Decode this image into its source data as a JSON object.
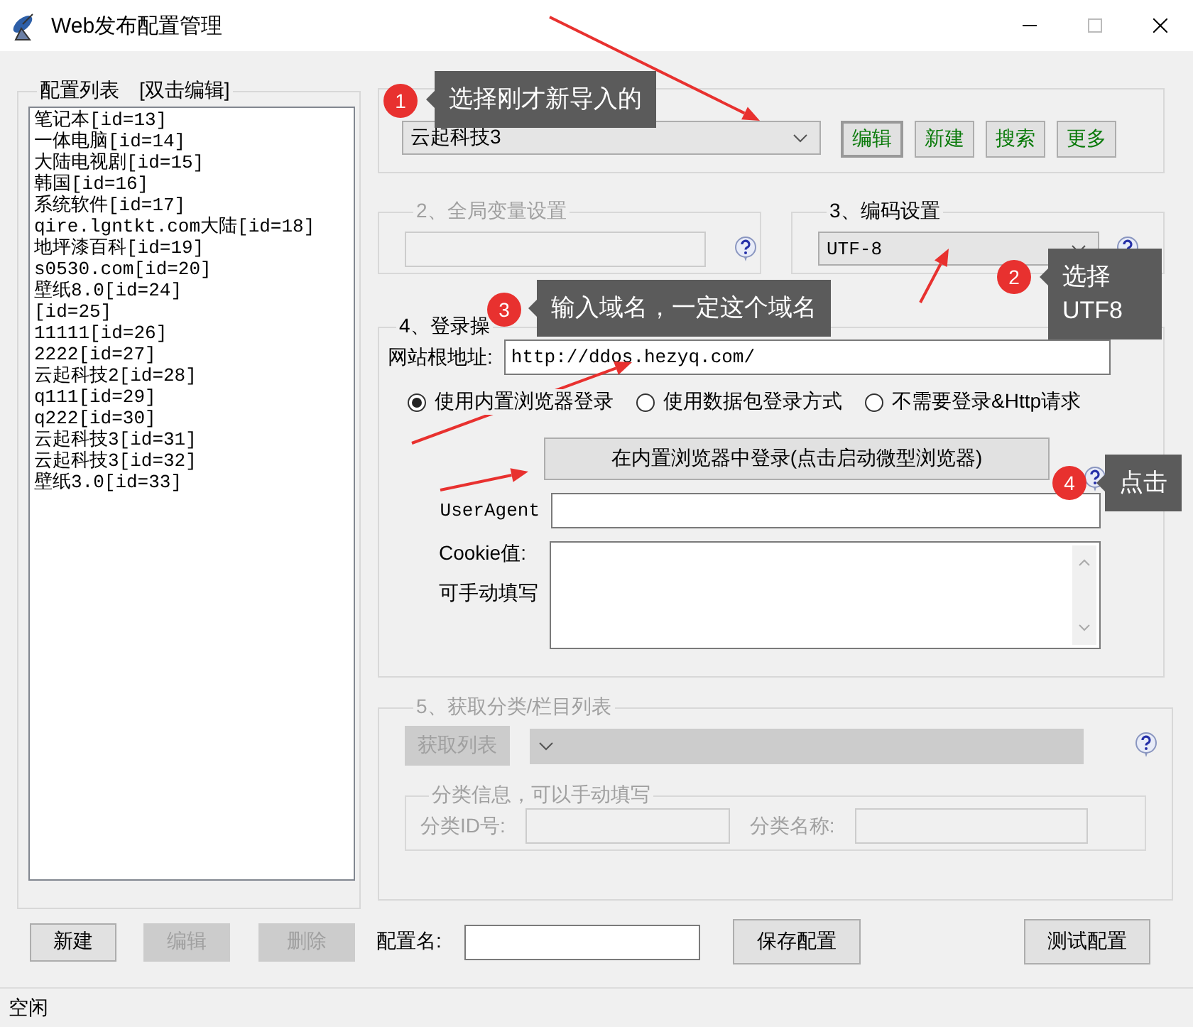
{
  "window": {
    "title": "Web发布配置管理"
  },
  "config_list": {
    "title": "配置列表",
    "hint": "[双击编辑]",
    "items": [
      "笔记本[id=13]",
      "一体电脑[id=14]",
      "大陆电视剧[id=15]",
      "韩国[id=16]",
      "系统软件[id=17]",
      "qire.lgntkt.com大陆[id=18]",
      "地坪漆百科[id=19]",
      "s0530.com[id=20]",
      "壁纸8.0[id=24]",
      "[id=25]",
      "11111[id=26]",
      "2222[id=27]",
      "云起科技2[id=28]",
      "q111[id=29]",
      "q222[id=30]",
      "云起科技3[id=31]",
      "云起科技3[id=32]",
      "壁纸3.0[id=33]"
    ]
  },
  "list_buttons": [
    {
      "label": "新建",
      "disabled": false
    },
    {
      "label": "编辑",
      "disabled": true
    },
    {
      "label": "删除",
      "disabled": true
    }
  ],
  "section1": {
    "selected_module": "云起科技3",
    "buttons": [
      "编辑",
      "新建",
      "搜索",
      "更多"
    ]
  },
  "section2": {
    "title": "2、全局变量设置",
    "disabled": true
  },
  "section3": {
    "title": "3、编码设置",
    "encoding": "UTF-8"
  },
  "section4": {
    "title": "4、登录操",
    "url_label": "网站根地址:",
    "url": "http://ddos.hezyq.com/",
    "login_modes": [
      {
        "label": "使用内置浏览器登录",
        "selected": true
      },
      {
        "label": "使用数据包登录方式",
        "selected": false
      },
      {
        "label": "不需要登录&Http请求",
        "selected": false
      }
    ],
    "login_button": "在内置浏览器中登录(点击启动微型浏览器)",
    "useragent_label": "UserAgent",
    "cookie_label": "Cookie值:",
    "cookie_hint": "可手动填写"
  },
  "section5": {
    "title": "5、获取分类/栏目列表",
    "disabled": true,
    "fetch_button": "获取列表",
    "category_group": {
      "title": "分类信息，可以手动填写",
      "id_label": "分类ID号:",
      "name_label": "分类名称:"
    }
  },
  "config_name_label": "配置名:",
  "save_button": "保存配置",
  "test_button": "测试配置",
  "status_bar": "空闲",
  "annotations": [
    {
      "number": "1",
      "text": "选择刚才新导入的"
    },
    {
      "number": "3",
      "text": "输入域名，一定这个域名"
    },
    {
      "number": "2",
      "text": "选择UTF8"
    },
    {
      "number": "4",
      "text": "点击"
    }
  ]
}
